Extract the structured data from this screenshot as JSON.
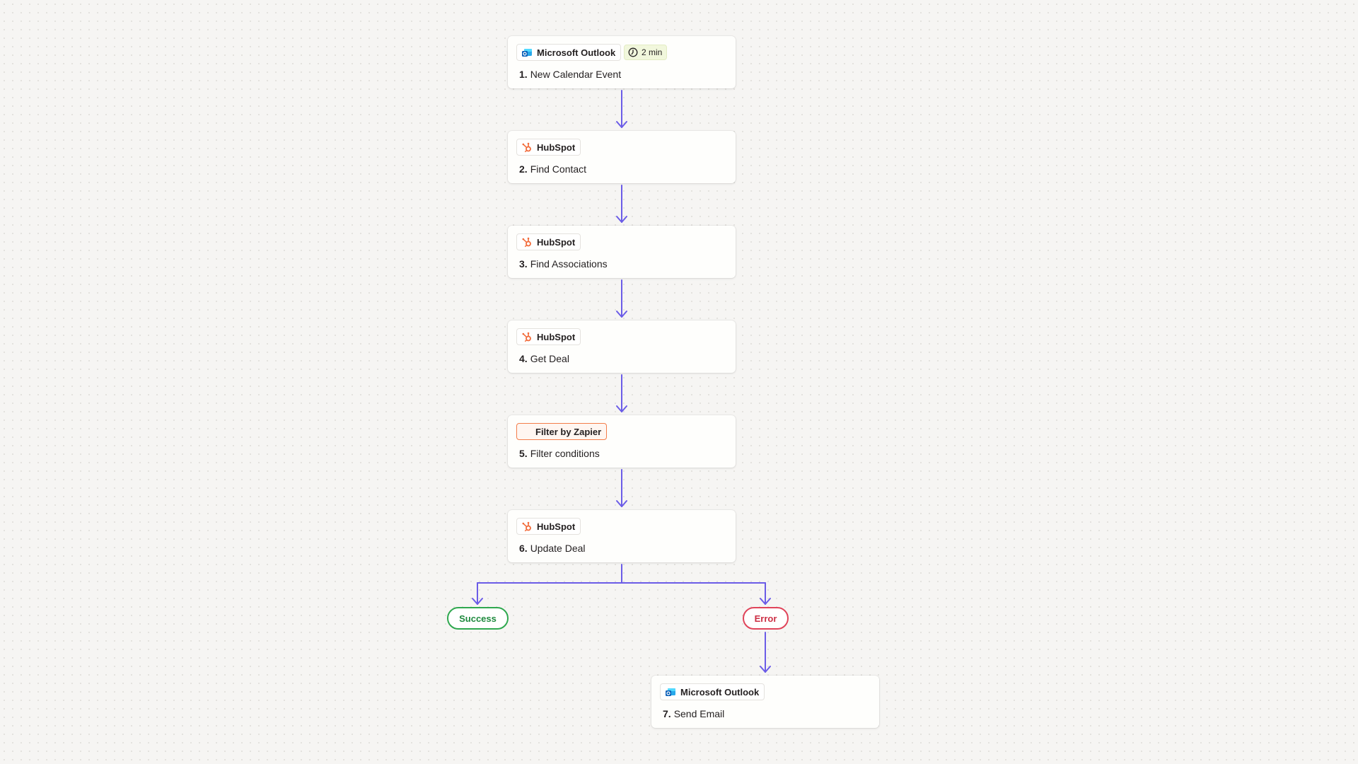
{
  "steps": [
    {
      "app": "Microsoft Outlook",
      "icon": "outlook-icon",
      "number": "1.",
      "title": "New Calendar Event",
      "time": "2 min"
    },
    {
      "app": "HubSpot",
      "icon": "hubspot-icon",
      "number": "2.",
      "title": "Find Contact"
    },
    {
      "app": "HubSpot",
      "icon": "hubspot-icon",
      "number": "3.",
      "title": "Find Associations"
    },
    {
      "app": "HubSpot",
      "icon": "hubspot-icon",
      "number": "4.",
      "title": "Get Deal"
    },
    {
      "app": "Filter by Zapier",
      "icon": "filter-icon",
      "number": "5.",
      "title": "Filter conditions"
    },
    {
      "app": "HubSpot",
      "icon": "hubspot-icon",
      "number": "6.",
      "title": "Update Deal"
    },
    {
      "app": "Microsoft Outlook",
      "icon": "outlook-icon",
      "number": "7.",
      "title": "Send Email"
    }
  ],
  "branches": {
    "success_label": "Success",
    "error_label": "Error"
  },
  "colors": {
    "connector": "#6b5ce7",
    "success": "#2fa84f",
    "error": "#e0445a",
    "hubspot": "#f26b3a",
    "filter_border": "#f47d4a",
    "time_badge": "#f1f7dc"
  }
}
